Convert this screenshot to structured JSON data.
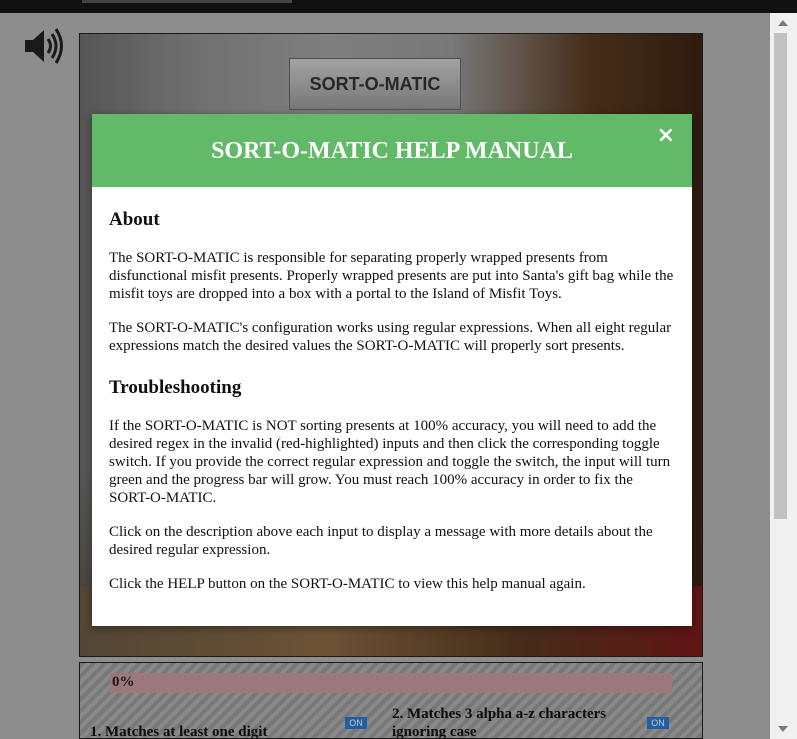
{
  "game": {
    "sign_text": "SORT-O-MATIC"
  },
  "controls": {
    "progress_label": "0%",
    "progress_value": 0,
    "rule1": "1. Matches at least one digit",
    "rule2": "2. Matches 3 alpha a-z characters ignoring case",
    "switch1_label": "ON",
    "switch2_label": "ON"
  },
  "modal": {
    "title": "SORT-O-MATIC HELP MANUAL",
    "close": "×",
    "about_heading": "About",
    "about_p1": "The SORT-O-MATIC is responsible for separating properly wrapped presents from disfunctional misfit presents. Properly wrapped presents are put into Santa's gift bag while the misfit toys are dropped into a box with a portal to the Island of Misfit Toys.",
    "about_p2": "The SORT-O-MATIC's configuration works using regular expressions. When all eight regular expressions match the desired values the SORT-O-MATIC will properly sort presents.",
    "trouble_heading": "Troubleshooting",
    "trouble_p1": "If the SORT-O-MATIC is NOT sorting presents at 100% accuracy, you will need to add the desired regex in the invalid (red-highlighted) inputs and then click the corresponding toggle switch. If you provide the correct regular expression and toggle the switch, the input will turn green and the progress bar will grow. You must reach 100% accuracy in order to fix the SORT-O-MATIC.",
    "trouble_p2": "Click on the description above each input to display a message with more details about the desired regular expression.",
    "trouble_p3": "Click the HELP button on the SORT-O-MATIC to view this help manual again."
  },
  "colors": {
    "modal_header": "#62b968",
    "progress_bar": "#c99a9e",
    "switch_on": "#2a7bd0"
  },
  "icons": {
    "sound": "speaker-icon",
    "close": "close-icon"
  }
}
